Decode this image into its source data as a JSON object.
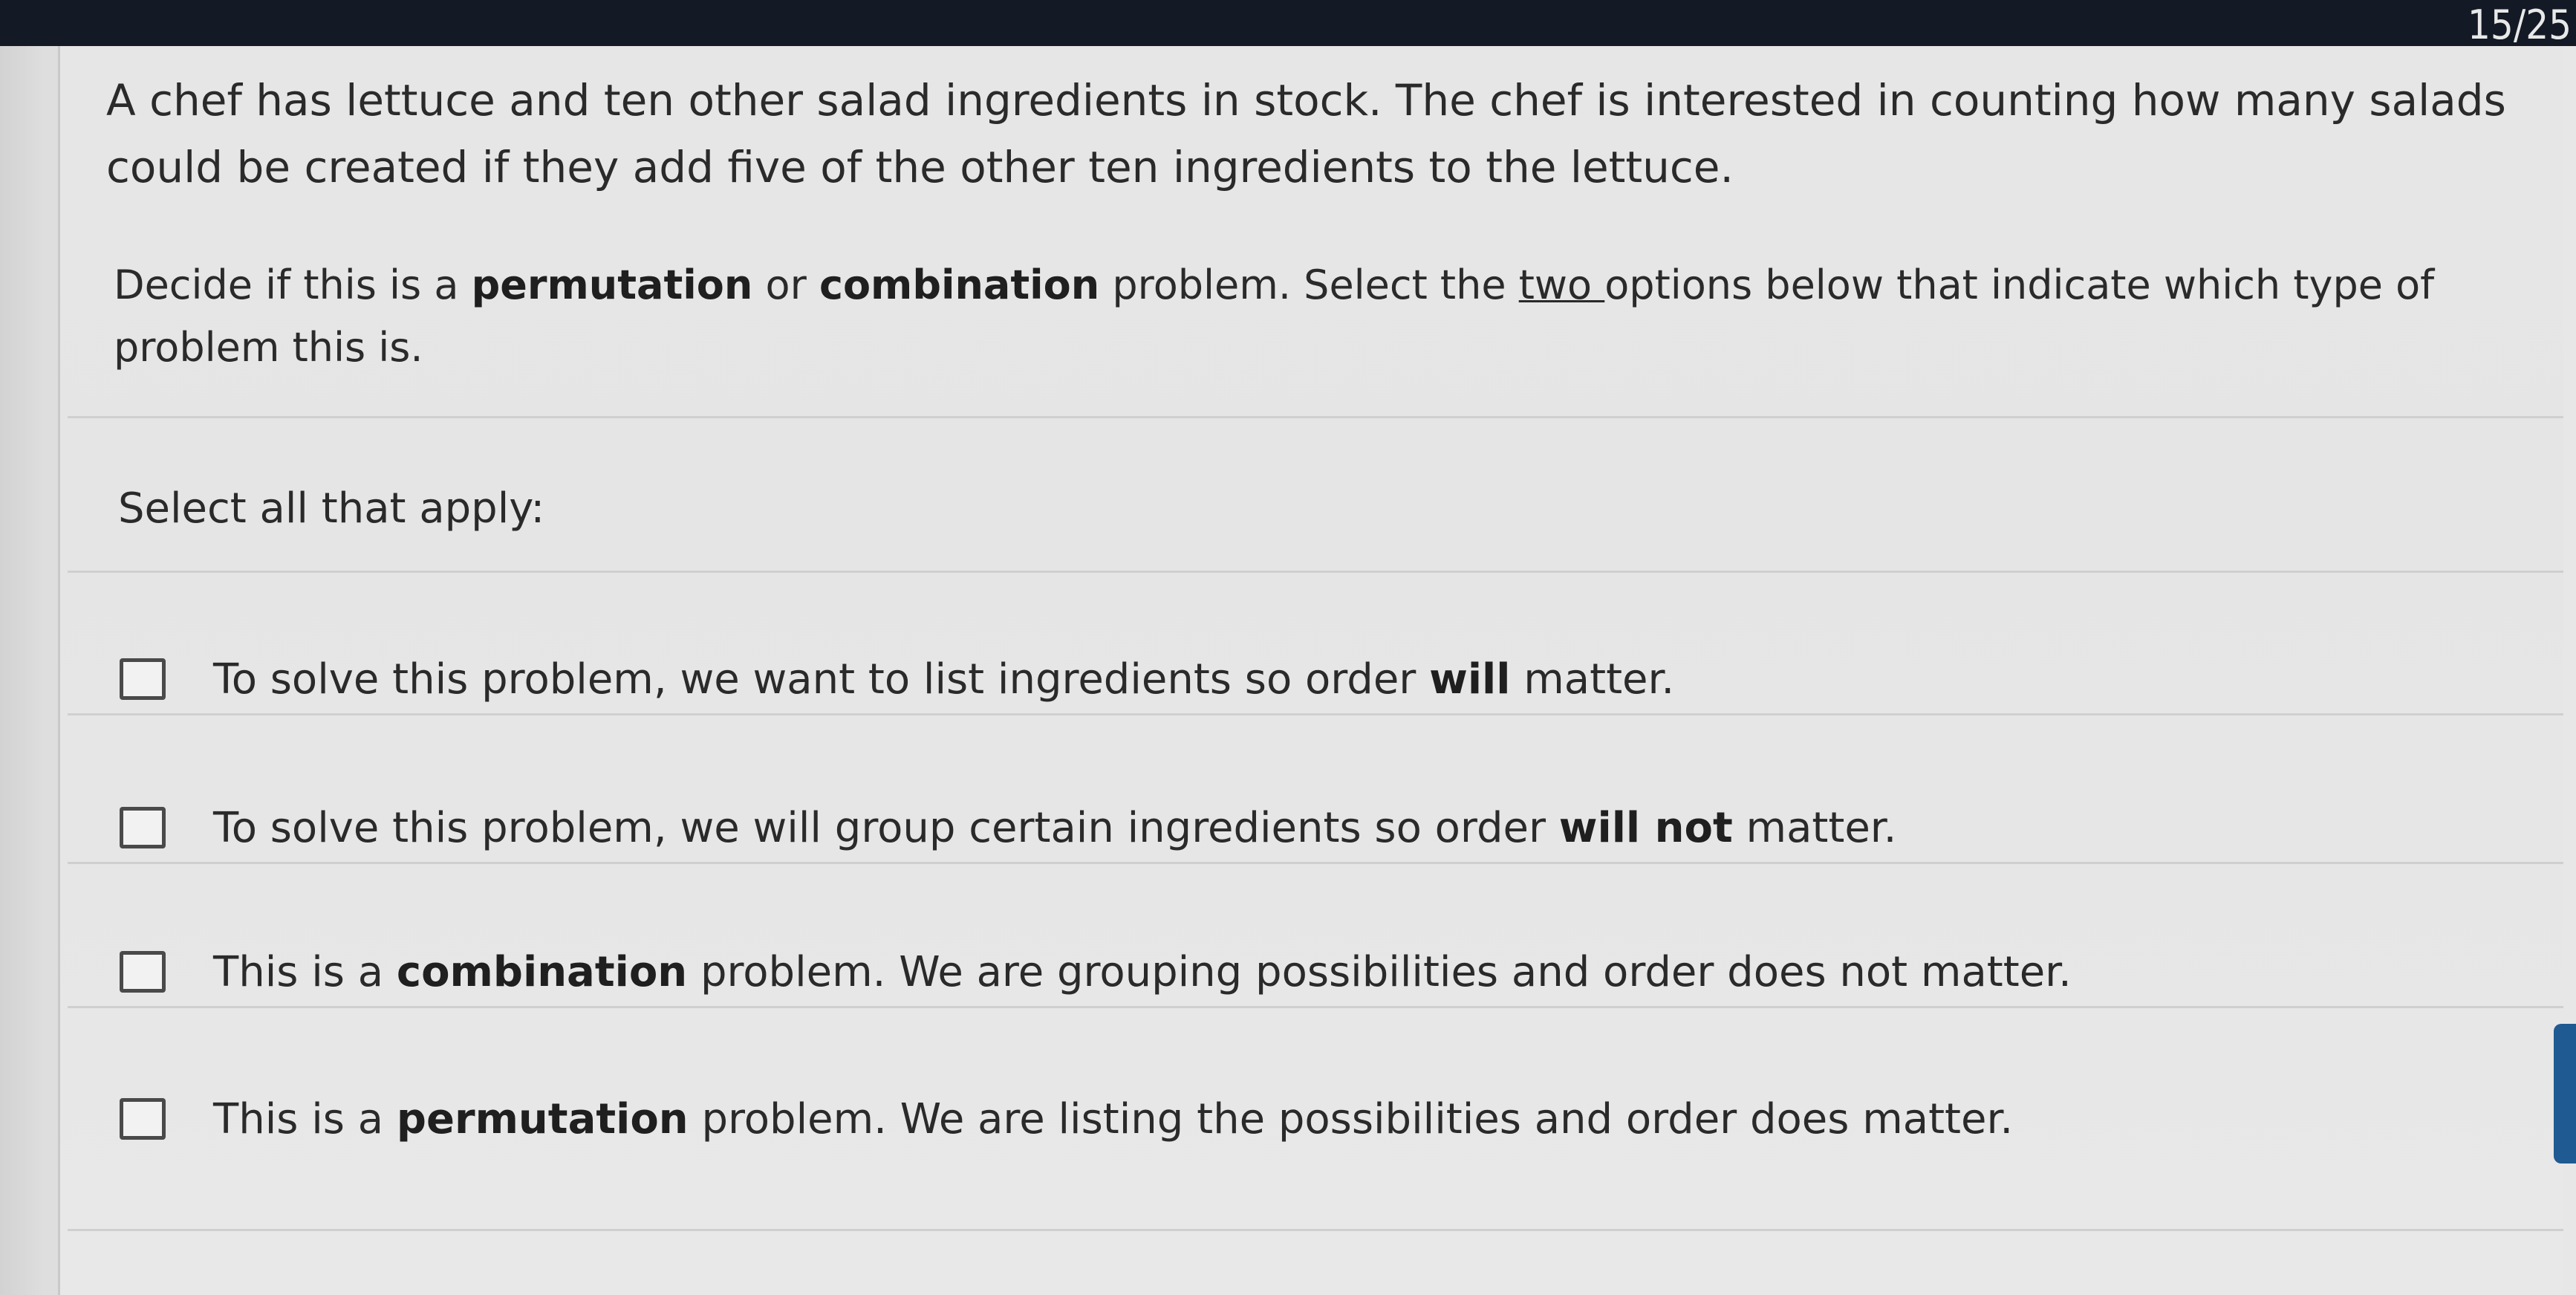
{
  "header": {
    "progress_counter": "15/25"
  },
  "question": {
    "stem": "A chef has lettuce and ten other salad ingredients in stock.  The chef is interested in counting how many salads could be created if they add five of the other ten ingredients to the lettuce.",
    "instruction": {
      "part1": "Decide if this is a ",
      "bold1": "permutation",
      "part2": " or ",
      "bold2": "combination",
      "part3": " problem. Select the ",
      "underlined": "two ",
      "part4": "options below that indicate which type of problem this is."
    },
    "select_label": "Select all that apply:"
  },
  "options": [
    {
      "pre": "To solve this problem, we want to list ingredients so order ",
      "bold": "will",
      "post": " matter."
    },
    {
      "pre": "To solve this problem, we will group certain ingredients so order ",
      "bold": "will not",
      "post": " matter."
    },
    {
      "pre": "This is a ",
      "bold": "combination",
      "post": " problem. We are grouping possibilities and order does not matter."
    },
    {
      "pre": "This is a ",
      "bold": "permutation",
      "post": " problem. We are listing the possibilities and order does matter."
    }
  ]
}
